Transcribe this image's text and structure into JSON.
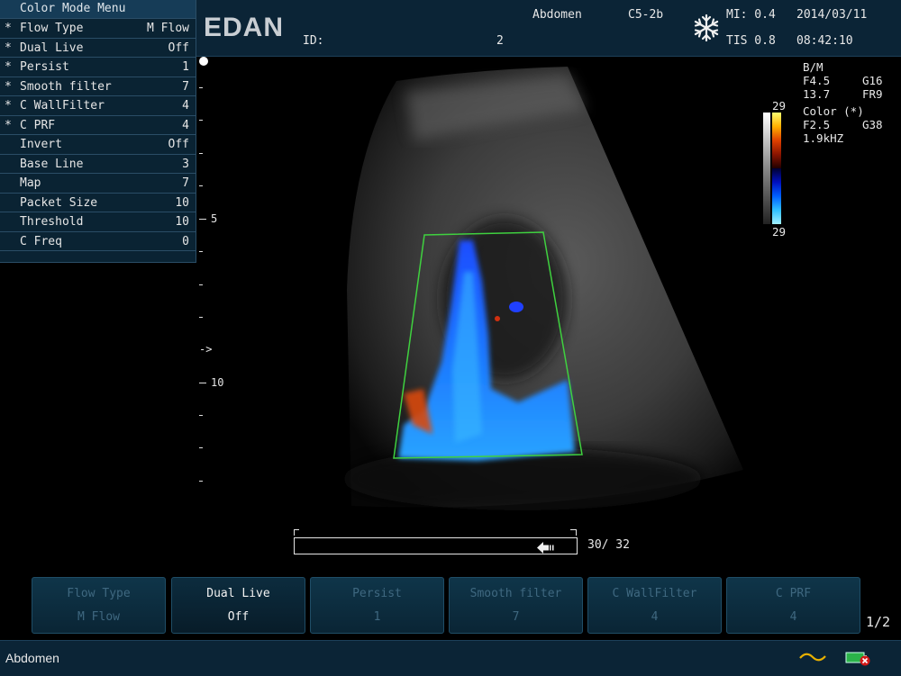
{
  "header": {
    "logo": "EDAN",
    "id_label": "ID:",
    "exam": "Abdomen",
    "probe": "C5-2b",
    "number": "2",
    "freeze_icon": "snowflake-icon",
    "mi": "MI: 0.4",
    "tis": "TIS 0.8",
    "date": "2014/03/11",
    "time": "08:42:10"
  },
  "menu": {
    "title": "Color Mode Menu",
    "items": [
      {
        "star": "*",
        "label": "Flow Type",
        "value": "M Flow"
      },
      {
        "star": "*",
        "label": "Dual Live",
        "value": "Off"
      },
      {
        "star": "*",
        "label": "Persist",
        "value": "1"
      },
      {
        "star": "*",
        "label": "Smooth filter",
        "value": "7"
      },
      {
        "star": "*",
        "label": "C WallFilter",
        "value": "4"
      },
      {
        "star": "*",
        "label": "C PRF",
        "value": "4"
      },
      {
        "star": "",
        "label": "Invert",
        "value": "Off"
      },
      {
        "star": "",
        "label": "Base Line",
        "value": "3"
      },
      {
        "star": "",
        "label": "Map",
        "value": "7"
      },
      {
        "star": "",
        "label": "Packet Size",
        "value": "10"
      },
      {
        "star": "",
        "label": "Threshold",
        "value": "10"
      },
      {
        "star": "",
        "label": "C Freq",
        "value": "0"
      }
    ]
  },
  "scale": {
    "label_5": "5",
    "label_10": "10",
    "focus_marker": "->"
  },
  "info": {
    "bm": "B/M",
    "f1": "F4.5",
    "g1": "G16",
    "d1": "13.7",
    "fr": "FR9",
    "color": "Color (*)",
    "f2": "F2.5",
    "g2": "G38",
    "prf": "1.9kHZ"
  },
  "colorbar": {
    "top": "29",
    "bottom": "29"
  },
  "cine": {
    "counter": "30/ 32",
    "progress": 0.94
  },
  "softkeys": [
    {
      "l1": "Flow Type",
      "l2": "M Flow",
      "state": "dim"
    },
    {
      "l1": "Dual Live",
      "l2": "Off",
      "state": "active"
    },
    {
      "l1": "Persist",
      "l2": "1",
      "state": "dim"
    },
    {
      "l1": "Smooth filter",
      "l2": "7",
      "state": "dim"
    },
    {
      "l1": "C WallFilter",
      "l2": "4",
      "state": "dim"
    },
    {
      "l1": "C PRF",
      "l2": "4",
      "state": "dim"
    }
  ],
  "page_indicator": "1/2",
  "footer": {
    "exam": "Abdomen",
    "signal_icon": "ecg-wave-icon",
    "battery_icon": "battery-error-icon"
  }
}
